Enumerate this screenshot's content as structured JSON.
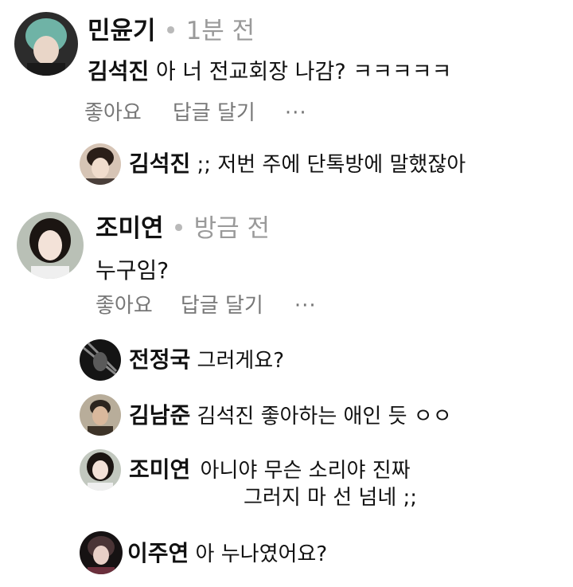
{
  "comments": [
    {
      "author": "민윤기",
      "time": "1분 전",
      "mention": "김석진",
      "text": "아 너 전교회장 나감? ㅋㅋㅋㅋㅋ",
      "like_label": "좋아요",
      "reply_label": "답글 달기",
      "more_label": "···",
      "replies": [
        {
          "author": "김석진",
          "text": ";; 저번 주에 단톡방에 말했잖아"
        }
      ]
    },
    {
      "author": "조미연",
      "time": "방금 전",
      "text": "누구임?",
      "like_label": "좋아요",
      "reply_label": "답글 달기",
      "more_label": "···",
      "replies": [
        {
          "author": "전정국",
          "text": "그러게요?"
        },
        {
          "author": "김남준",
          "text": "김석진 좋아하는 애인 듯 ㅇㅇ"
        },
        {
          "author": "조미연",
          "text": "아니야 무슨 소리야 진짜",
          "text2": "그러지 마 선 넘네 ;;"
        },
        {
          "author": "이주연",
          "text": "아 누나였어요?"
        }
      ]
    }
  ],
  "separator_dot": "•"
}
